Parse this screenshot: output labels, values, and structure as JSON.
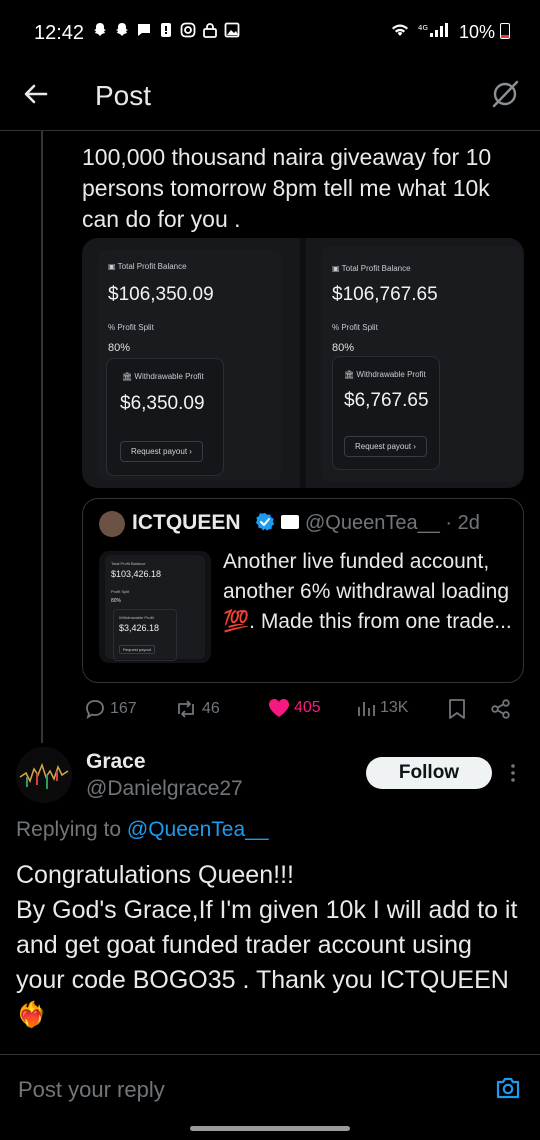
{
  "status_bar": {
    "time": "12:42",
    "battery": "10%"
  },
  "header": {
    "title": "Post"
  },
  "post": {
    "text": "100,000 thousand naira giveaway for 10 persons tomorrow 8pm tell me what 10k can do for you .",
    "media": [
      {
        "balance_label": "Total Profit Balance",
        "balance": "$106,350.09",
        "split_label": "Profit Split",
        "split": "80%",
        "withdrawable_label": "Withdrawable Profit",
        "withdrawable": "$6,350.09",
        "button": "Request payout"
      },
      {
        "balance_label": "Total Profit Balance",
        "balance": "$106,767.65",
        "split_label": "Profit Split",
        "split": "80%",
        "withdrawable_label": "Withdrawable Profit",
        "withdrawable": "$6,767.65",
        "button": "Request payout"
      }
    ],
    "quote": {
      "name": "ICTQUEEN",
      "handle": "@QueenTea__ · 2d",
      "text": "Another live funded account, another 6% withdrawal loading 💯. Made this from one trade...",
      "thumb": {
        "balance_label": "Total Profit Balance",
        "balance": "$103,426.18",
        "split_label": "Profit Split",
        "split": "80%",
        "withdrawable_label": "Withdrawable Profit",
        "withdrawable": "$3,426.18",
        "button": "Request payout"
      }
    },
    "actions": {
      "replies": "167",
      "reposts": "46",
      "likes": "405",
      "views": "13K"
    }
  },
  "reply": {
    "name": "Grace",
    "handle": "@Danielgrace27",
    "follow_label": "Follow",
    "replying_prefix": "Replying to",
    "replying_mention": "@QueenTea__",
    "text": "Congratulations Queen!!!\nBy God's Grace,If I'm given 10k I will add to it and get goat funded trader account using your code BOGO35 . Thank you ICTQUEEN ❤️‍🔥"
  },
  "composer": {
    "placeholder": "Post your reply"
  },
  "colors": {
    "accent": "#1d9bf0",
    "like": "#f91880",
    "background": "#000000"
  }
}
